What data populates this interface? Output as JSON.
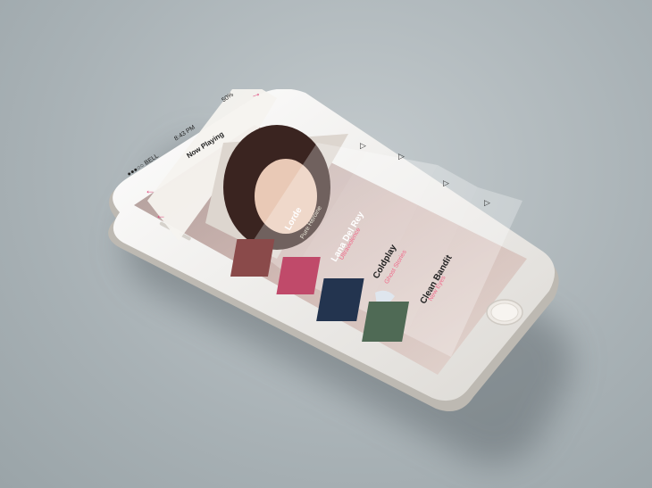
{
  "status_bar": {
    "carrier": "●●●○○ BELL",
    "time": "8:43 PM",
    "battery": "50%"
  },
  "header": {
    "title": "Now Playing",
    "back_arrow": "←",
    "forward_arrow": "→"
  },
  "play_icon": "▷",
  "tracks": [
    {
      "artist": "Lorde",
      "album": "Pure Heroine"
    },
    {
      "artist": "Lana Del Rey",
      "album": "Ultraviolence"
    },
    {
      "artist": "Coldplay",
      "album": "Ghost Stories"
    },
    {
      "artist": "Clean Bandit",
      "album": "New Eyes"
    }
  ],
  "colors": {
    "accent": "#e0447a",
    "background": "#a9b2b6",
    "phone": "#f2f0ec"
  }
}
